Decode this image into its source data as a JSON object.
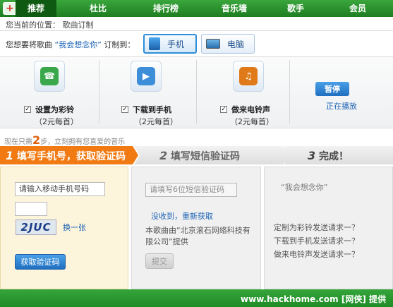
{
  "nav": {
    "items": [
      "推荐",
      "杜比",
      "排行榜",
      "音乐墙",
      "歌手",
      "会员"
    ],
    "active_index": 0
  },
  "location": {
    "text": "您当前的位置：  歌曲订制"
  },
  "prompt": {
    "before": "您想要将歌曲",
    "song": "“我会想念你”",
    "after": "订制到：",
    "devices": [
      {
        "label": "手机",
        "icon": "phone-icon",
        "selected": true
      },
      {
        "label": "电脑",
        "icon": "computer-icon",
        "selected": false
      }
    ]
  },
  "options": [
    {
      "label": "设置为彩铃",
      "price": "（2元每首）",
      "icon": "ringback-icon",
      "checked": true
    },
    {
      "label": "下载到手机",
      "price": "（2元每首）",
      "icon": "download-play-icon",
      "checked": true
    },
    {
      "label": "做来电铃声",
      "price": "（2元每首）",
      "icon": "music-note-icon",
      "checked": true
    }
  ],
  "player": {
    "pause_label": "暂停",
    "status": "正在播放"
  },
  "slogan": {
    "before": "现在只需",
    "num": "2",
    "after": "步，立刻拥有您喜爱的音乐"
  },
  "steps": [
    {
      "num": "1",
      "text": "填写手机号，获取验证码"
    },
    {
      "num": "2",
      "text": "填写短信验证码"
    },
    {
      "num": "3",
      "text": "完成！"
    }
  ],
  "step1_panel": {
    "phone_placeholder": "请输入移动手机号码",
    "captcha_text": "2JUC",
    "refresh_label": "换一张",
    "get_code_label": "获取验证码"
  },
  "step2_panel": {
    "code_placeholder": "请填写6位短信验证码",
    "not_received": "没收到，",
    "reget": "重新获取",
    "provider": "本歌曲由“北京滚石网络科技有限公司”提供",
    "submit_label": "提交"
  },
  "step3_panel": {
    "song": "“我会想念你”",
    "lines": [
      "定制为彩铃发送请求一？",
      "下载到手机发送请求一？",
      "做来电铃声发送请求一？"
    ]
  },
  "footer": {
    "text": "www.hackhome.com [网侠] 提供"
  },
  "colors": {
    "nav_green": "#2a9a30",
    "step_orange": "#f27a12",
    "link_blue": "#1a62b4"
  }
}
